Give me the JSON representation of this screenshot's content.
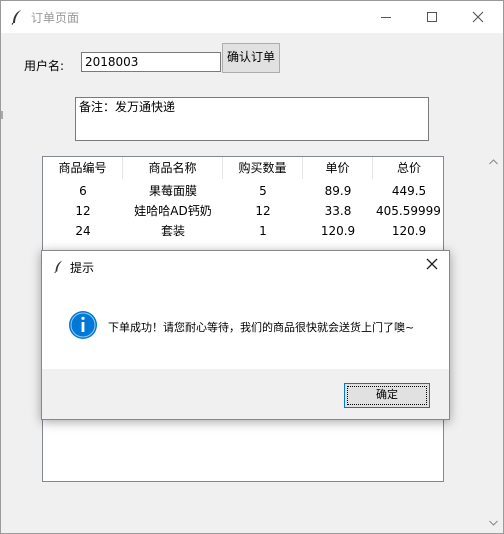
{
  "window": {
    "title": "订单页面"
  },
  "form": {
    "username_label": "用户名:",
    "username_value": "2018003",
    "confirm_button": "确认订单",
    "remark_value": "备注：发万通快递"
  },
  "table": {
    "headers": [
      "商品编号",
      "商品名称",
      "购买数量",
      "单价",
      "总价"
    ],
    "rows": [
      [
        "6",
        "果莓面膜",
        "5",
        "89.9",
        "449.5"
      ],
      [
        "12",
        "娃哈哈AD钙奶",
        "12",
        "33.8",
        "405.59999"
      ],
      [
        "24",
        "套装",
        "1",
        "120.9",
        "120.9"
      ]
    ]
  },
  "dialog": {
    "title": "提示",
    "message": "下单成功！请您耐心等待，我们的商品很快就会送货上门了噢~",
    "ok_button": "确定"
  },
  "icons": [
    "feather-icon",
    "minimize-icon",
    "maximize-icon",
    "close-icon",
    "info-icon",
    "scroll-up-icon",
    "scroll-down-icon"
  ],
  "colors": {
    "info_blue": "#0078d7",
    "ok_border": "#0078d7"
  }
}
